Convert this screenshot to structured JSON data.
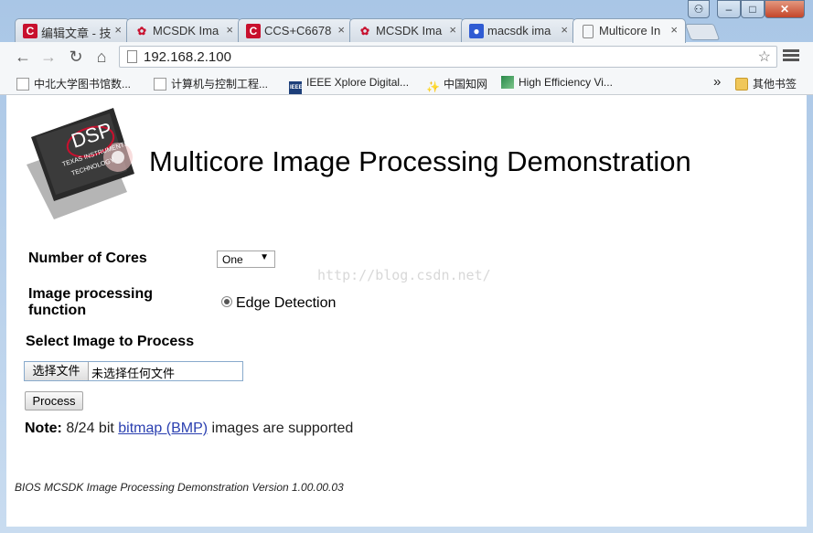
{
  "tabs": [
    {
      "title": "编辑文章 - 技",
      "icon": "csdn-c-icon",
      "active": false
    },
    {
      "title": "MCSDK Ima",
      "icon": "ti-icon",
      "active": false
    },
    {
      "title": "CCS+C6678",
      "icon": "csdn-c-icon",
      "active": false
    },
    {
      "title": "MCSDK Ima",
      "icon": "ti-icon",
      "active": false
    },
    {
      "title": "macsdk ima",
      "icon": "baidu-paw-icon",
      "active": false
    },
    {
      "title": "Multicore In",
      "icon": "page-icon",
      "active": true
    }
  ],
  "tab_close_glyph": "×",
  "address": {
    "url": "192.168.2.100"
  },
  "bookmarks": [
    {
      "label": "中北大学图书馆数...",
      "icon": "page-icon"
    },
    {
      "label": "计算机与控制工程...",
      "icon": "page-icon"
    },
    {
      "label": "IEEE Xplore Digital...",
      "icon": "ieee-icon"
    },
    {
      "label": "中国知网",
      "icon": "cnki-icon"
    },
    {
      "label": "High Efficiency Vi...",
      "icon": "hevc-icon"
    }
  ],
  "bookmarks_overflow": "»",
  "other_bookmarks": "其他书签",
  "page": {
    "title": "Multicore Image Processing Demonstration",
    "logo": {
      "line1": "DSP",
      "line2": "TEXAS INSTRUMENTS",
      "line3": "TECHNOLOGY"
    },
    "cores_label": "Number of Cores",
    "cores_value": "One",
    "function_label_1": "Image processing",
    "function_label_2": "function",
    "function_option": "Edge Detection",
    "select_image_label": "Select Image to Process",
    "choose_file_button": "选择文件",
    "no_file_text": "未选择任何文件",
    "process_button": "Process",
    "note_prefix": "Note:",
    "note_text_1": " 8/24 bit ",
    "note_link": "bitmap (BMP)",
    "note_text_2": " images are supported",
    "footer": "BIOS MCSDK Image Processing Demonstration Version 1.00.00.03",
    "watermark": "http://blog.csdn.net/"
  },
  "colors": {
    "accent_link": "#2a3fb0",
    "ti_red": "#c8102e"
  }
}
